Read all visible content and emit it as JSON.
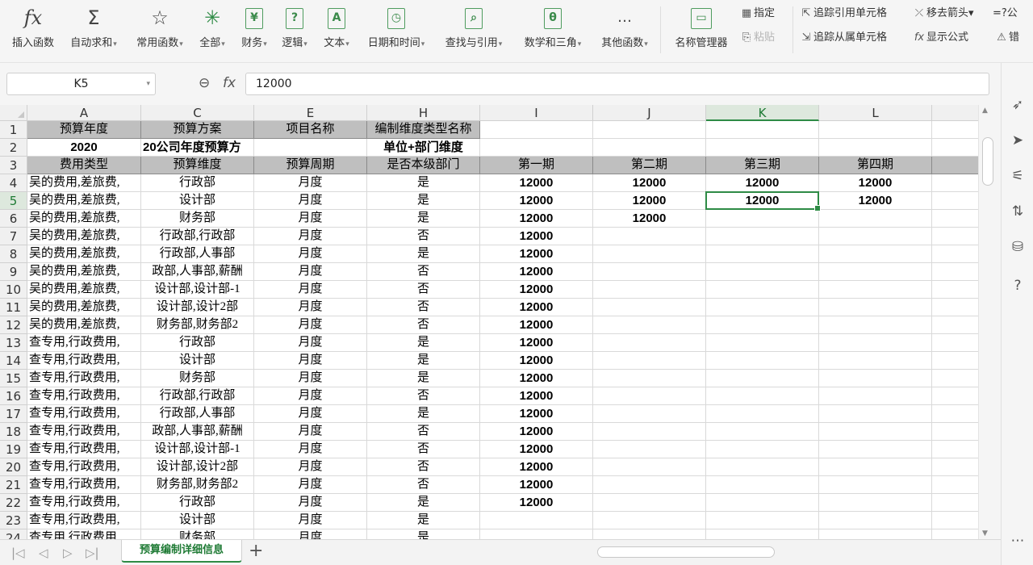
{
  "ribbon": {
    "insert_function": {
      "icon": "fx",
      "label": "插入函数"
    },
    "autosum": {
      "icon": "Σ",
      "label": "自动求和"
    },
    "common_functions": {
      "icon": "☆",
      "label": "常用函数"
    },
    "all": {
      "icon": "✳",
      "label": "全部"
    },
    "finance": {
      "icon": "¥",
      "label": "财务"
    },
    "logic": {
      "icon": "?",
      "label": "逻辑"
    },
    "text": {
      "icon": "A",
      "label": "文本"
    },
    "datetime": {
      "icon": "◷",
      "label": "日期和时间"
    },
    "lookup": {
      "icon": "⌕",
      "label": "查找与引用"
    },
    "math": {
      "icon": "θ",
      "label": "数学和三角"
    },
    "other": {
      "icon": "…",
      "label": "其他函数"
    },
    "name_manager": {
      "label": "名称管理器"
    },
    "specify": "指定",
    "paste": "粘贴",
    "trace_precedents": "追踪引用单元格",
    "trace_dependents": "追踪从属单元格",
    "remove_arrows": "移去箭头",
    "show_formulas": "显示公式",
    "cut_extra1": "=?",
    "cut_extra2": "公",
    "cut_extra3": "错"
  },
  "formula_bar": {
    "name_box": "K5",
    "value": "12000"
  },
  "columns": [
    "A",
    "C",
    "E",
    "H",
    "I",
    "J",
    "K",
    "L"
  ],
  "rows": [
    {
      "n": "1",
      "cells": [
        "预算年度",
        "预算方案",
        "项目名称",
        "编制维度类型名称",
        "",
        "",
        "",
        ""
      ]
    },
    {
      "n": "2",
      "cells": [
        "2020",
        "20公司年度预算方",
        "",
        "单位+部门维度",
        "",
        "",
        "",
        ""
      ]
    },
    {
      "n": "3",
      "cells": [
        "费用类型",
        "预算维度",
        "预算周期",
        "是否本级部门",
        "第一期",
        "第二期",
        "第三期",
        "第四期"
      ]
    },
    {
      "n": "4",
      "cells": [
        "吴的费用,差旅费,",
        "行政部",
        "月度",
        "是",
        "12000",
        "12000",
        "12000",
        "12000"
      ]
    },
    {
      "n": "5",
      "cells": [
        "吴的费用,差旅费,",
        "设计部",
        "月度",
        "是",
        "12000",
        "12000",
        "12000",
        "12000"
      ]
    },
    {
      "n": "6",
      "cells": [
        "吴的费用,差旅费,",
        "财务部",
        "月度",
        "是",
        "12000",
        "12000",
        "",
        ""
      ]
    },
    {
      "n": "7",
      "cells": [
        "吴的费用,差旅费,",
        "行政部,行政部",
        "月度",
        "否",
        "12000",
        "",
        "",
        ""
      ]
    },
    {
      "n": "8",
      "cells": [
        "吴的费用,差旅费,",
        "行政部,人事部",
        "月度",
        "是",
        "12000",
        "",
        "",
        ""
      ]
    },
    {
      "n": "9",
      "cells": [
        "吴的费用,差旅费,",
        "政部,人事部,薪酬",
        "月度",
        "否",
        "12000",
        "",
        "",
        ""
      ]
    },
    {
      "n": "10",
      "cells": [
        "吴的费用,差旅费,",
        "设计部,设计部-1",
        "月度",
        "否",
        "12000",
        "",
        "",
        ""
      ]
    },
    {
      "n": "11",
      "cells": [
        "吴的费用,差旅费,",
        "设计部,设计2部",
        "月度",
        "否",
        "12000",
        "",
        "",
        ""
      ]
    },
    {
      "n": "12",
      "cells": [
        "吴的费用,差旅费,",
        "财务部,财务部2",
        "月度",
        "否",
        "12000",
        "",
        "",
        ""
      ]
    },
    {
      "n": "13",
      "cells": [
        "查专用,行政费用,",
        "行政部",
        "月度",
        "是",
        "12000",
        "",
        "",
        ""
      ]
    },
    {
      "n": "14",
      "cells": [
        "查专用,行政费用,",
        "设计部",
        "月度",
        "是",
        "12000",
        "",
        "",
        ""
      ]
    },
    {
      "n": "15",
      "cells": [
        "查专用,行政费用,",
        "财务部",
        "月度",
        "是",
        "12000",
        "",
        "",
        ""
      ]
    },
    {
      "n": "16",
      "cells": [
        "查专用,行政费用,",
        "行政部,行政部",
        "月度",
        "否",
        "12000",
        "",
        "",
        ""
      ]
    },
    {
      "n": "17",
      "cells": [
        "查专用,行政费用,",
        "行政部,人事部",
        "月度",
        "是",
        "12000",
        "",
        "",
        ""
      ]
    },
    {
      "n": "18",
      "cells": [
        "查专用,行政费用,",
        "政部,人事部,薪酬",
        "月度",
        "否",
        "12000",
        "",
        "",
        ""
      ]
    },
    {
      "n": "19",
      "cells": [
        "查专用,行政费用,",
        "设计部,设计部-1",
        "月度",
        "否",
        "12000",
        "",
        "",
        ""
      ]
    },
    {
      "n": "20",
      "cells": [
        "查专用,行政费用,",
        "设计部,设计2部",
        "月度",
        "否",
        "12000",
        "",
        "",
        ""
      ]
    },
    {
      "n": "21",
      "cells": [
        "查专用,行政费用,",
        "财务部,财务部2",
        "月度",
        "否",
        "12000",
        "",
        "",
        ""
      ]
    },
    {
      "n": "22",
      "cells": [
        "查专用,行政费用,",
        "行政部",
        "月度",
        "是",
        "12000",
        "",
        "",
        ""
      ]
    },
    {
      "n": "23",
      "cells": [
        "查专用,行政费用,",
        "设计部",
        "月度",
        "是",
        "",
        "",
        "",
        ""
      ]
    },
    {
      "n": "24",
      "cells": [
        "查专用,行政费用,",
        "财务部",
        "月度",
        "是",
        "",
        "",
        "",
        ""
      ]
    }
  ],
  "sheet_tab": "预算编制详细信息",
  "colors": {
    "accent": "#2e8b45",
    "header_fill": "#bfbfbf"
  }
}
